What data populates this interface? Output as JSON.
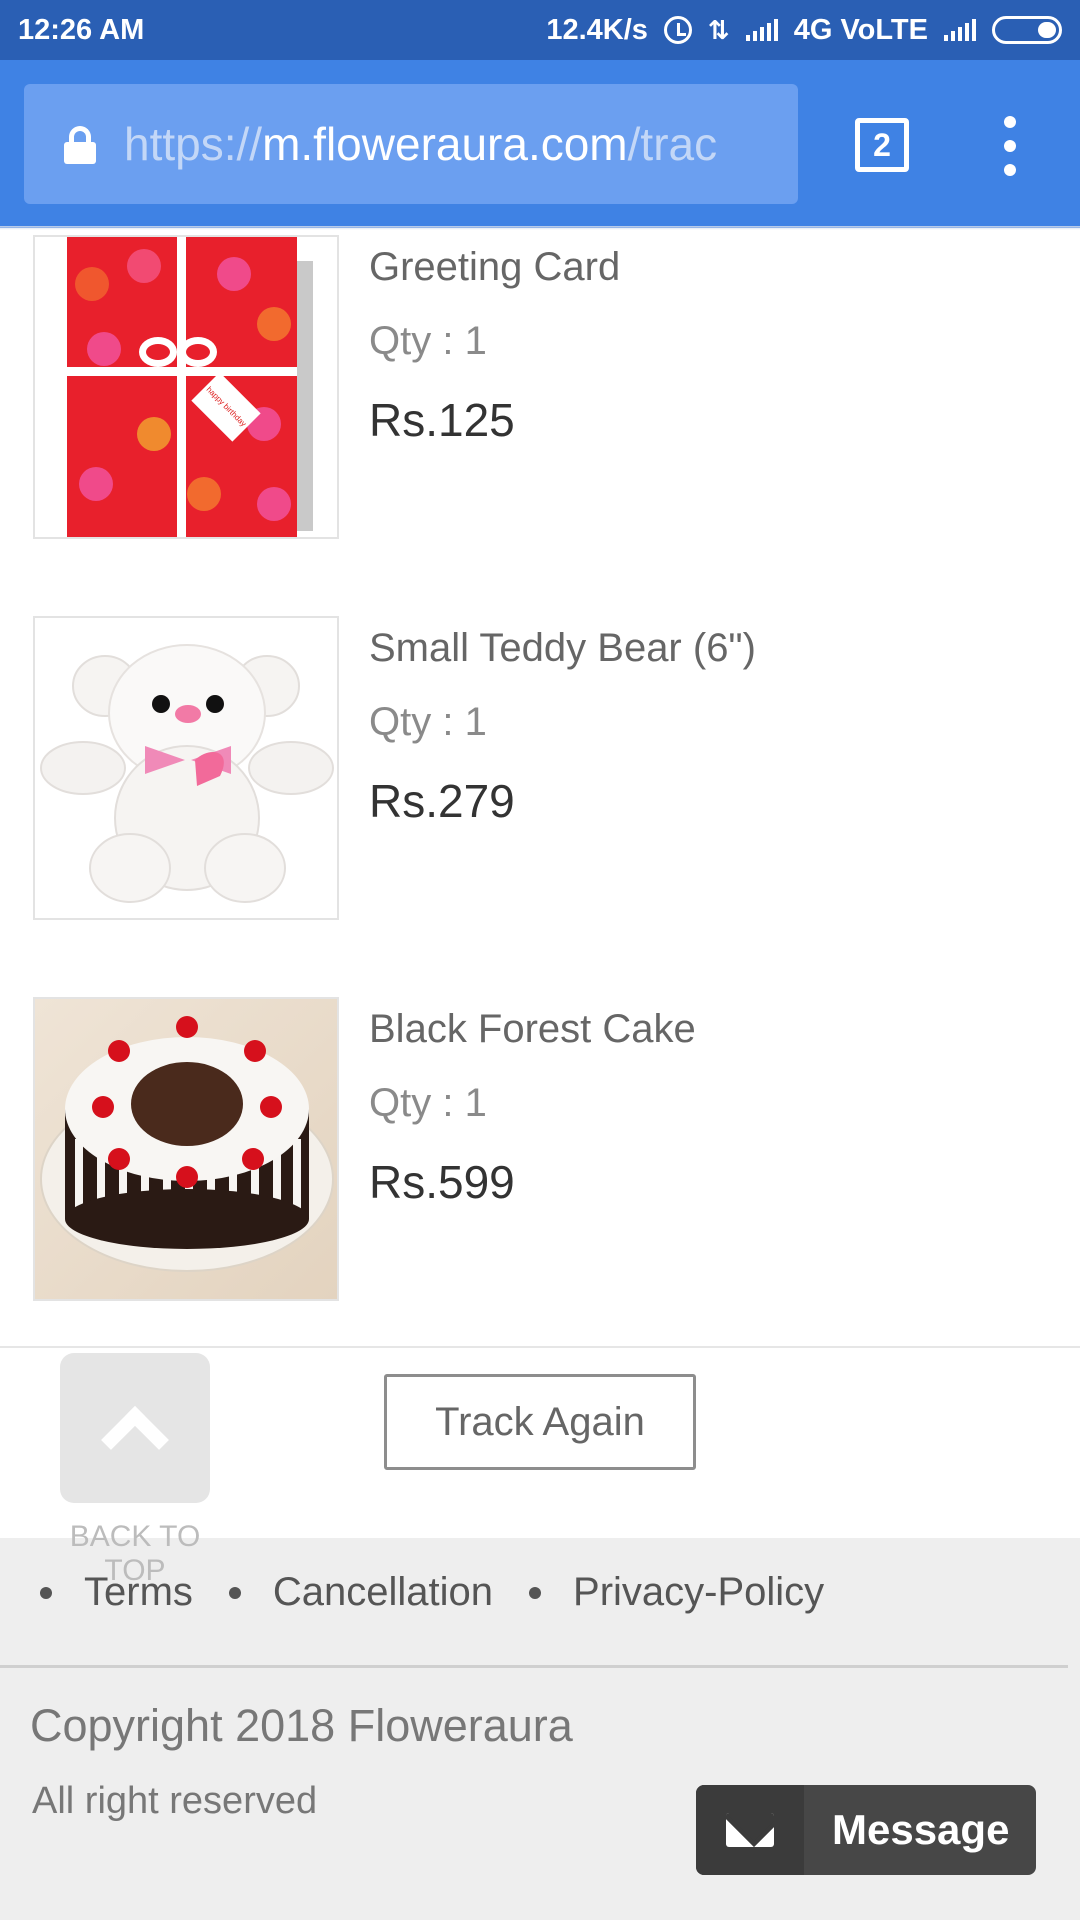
{
  "status_bar": {
    "time": "12:26 AM",
    "net_speed": "12.4K/s",
    "network": "4G VoLTE"
  },
  "browser": {
    "url_proto": "https://",
    "url_host": "m.floweraura.com",
    "url_path": "/trac",
    "tab_count": "2"
  },
  "products": [
    {
      "name": "Greeting Card",
      "qty": "Qty : 1",
      "price": "Rs.125",
      "image": "greeting-card-image"
    },
    {
      "name": "Small Teddy Bear (6\")",
      "qty": "Qty : 1",
      "price": "Rs.279",
      "image": "teddy-bear-image"
    },
    {
      "name": "Black Forest Cake",
      "qty": "Qty : 1",
      "price": "Rs.599",
      "image": "cake-image"
    }
  ],
  "actions": {
    "track_again": "Track Again",
    "back_to_top": "BACK TO TOP"
  },
  "footer": {
    "links": [
      "Terms",
      "Cancellation",
      "Privacy-Policy"
    ],
    "copyright": "Copyright 2018 Floweraura",
    "rights": "All right reserved"
  },
  "message_button": {
    "label": "Message"
  },
  "colors": {
    "status_bar": "#2a5fb4",
    "toolbar": "#3f82e4",
    "url_box": "#6b9ff0",
    "footer_bg": "#eeeeee",
    "message_bg": "#474747"
  }
}
